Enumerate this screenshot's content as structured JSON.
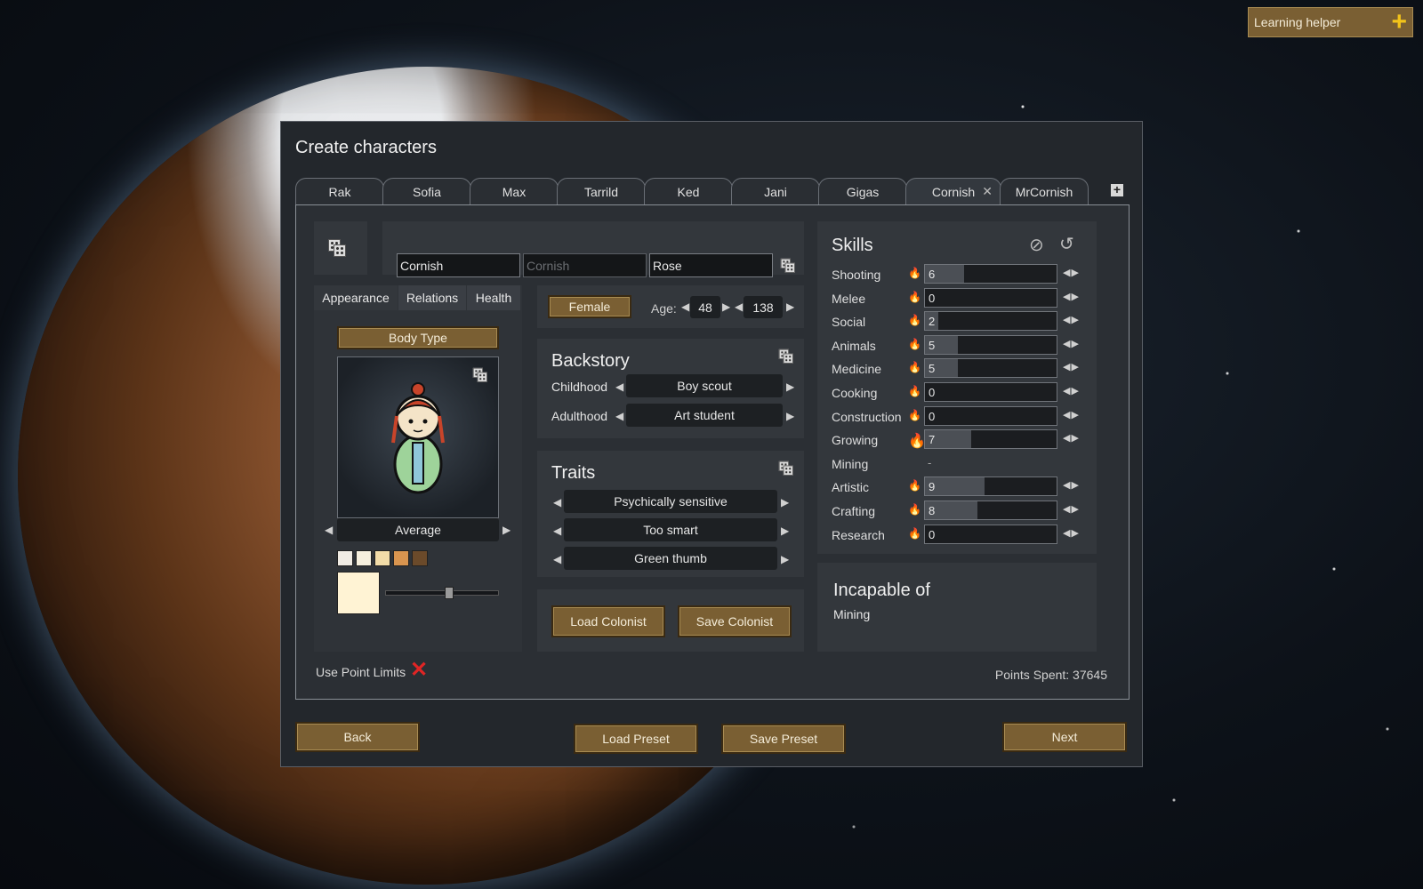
{
  "learning_helper": {
    "label": "Learning helper"
  },
  "window": {
    "title": "Create characters"
  },
  "tabs": [
    {
      "label": "Rak"
    },
    {
      "label": "Sofia"
    },
    {
      "label": "Max"
    },
    {
      "label": "Tarrild"
    },
    {
      "label": "Ked"
    },
    {
      "label": "Jani"
    },
    {
      "label": "Gigas"
    },
    {
      "label": "Cornish",
      "active": true
    },
    {
      "label": "MrCornish"
    }
  ],
  "name": {
    "first": "Cornish",
    "nick_placeholder": "Cornish",
    "last": "Rose"
  },
  "subtabs": {
    "appearance": "Appearance",
    "relations": "Relations",
    "health": "Health"
  },
  "appearance": {
    "body_type_label": "Body Type",
    "body_type_value": "Average",
    "skin_swatches": [
      "#f0ece4",
      "#f6f0de",
      "#f2dca8",
      "#d9954f",
      "#6b4a2a"
    ],
    "selected_skin": "#fff3d4"
  },
  "gender": "Female",
  "age": {
    "label": "Age:",
    "biological": "48",
    "chronological": "138"
  },
  "backstory": {
    "title": "Backstory",
    "childhood_label": "Childhood",
    "childhood_value": "Boy scout",
    "adulthood_label": "Adulthood",
    "adulthood_value": "Art student"
  },
  "traits": {
    "title": "Traits",
    "items": [
      "Psychically sensitive",
      "Too smart",
      "Green thumb"
    ]
  },
  "colonist_buttons": {
    "load": "Load Colonist",
    "save": "Save Colonist"
  },
  "skills": {
    "title": "Skills",
    "max_level": 20,
    "items": [
      {
        "name": "Shooting",
        "value": "6",
        "level": 6,
        "passion": "none"
      },
      {
        "name": "Melee",
        "value": "0",
        "level": 0,
        "passion": "none"
      },
      {
        "name": "Social",
        "value": "2",
        "level": 2,
        "passion": "none"
      },
      {
        "name": "Animals",
        "value": "5",
        "level": 5,
        "passion": "minor"
      },
      {
        "name": "Medicine",
        "value": "5",
        "level": 5,
        "passion": "none"
      },
      {
        "name": "Cooking",
        "value": "0",
        "level": 0,
        "passion": "none"
      },
      {
        "name": "Construction",
        "value": "0",
        "level": 0,
        "passion": "none"
      },
      {
        "name": "Growing",
        "value": "7",
        "level": 7,
        "passion": "major"
      },
      {
        "name": "Mining",
        "value": "-",
        "level": null,
        "passion": "disabled"
      },
      {
        "name": "Artistic",
        "value": "9",
        "level": 9,
        "passion": "minor"
      },
      {
        "name": "Crafting",
        "value": "8",
        "level": 8,
        "passion": "minor"
      },
      {
        "name": "Research",
        "value": "0",
        "level": 0,
        "passion": "none"
      }
    ]
  },
  "incapable": {
    "title": "Incapable of",
    "items": [
      "Mining"
    ]
  },
  "footer": {
    "use_point_limits": "Use Point Limits",
    "points_spent": "Points Spent: 37645"
  },
  "bottom_buttons": {
    "back": "Back",
    "load_preset": "Load Preset",
    "save_preset": "Save Preset",
    "next": "Next"
  }
}
